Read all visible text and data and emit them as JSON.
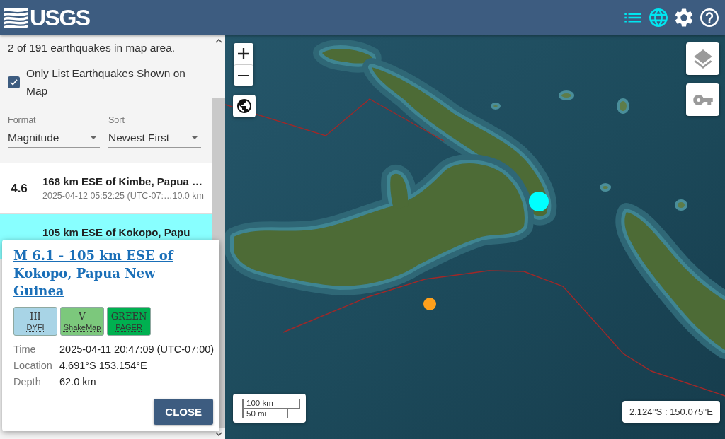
{
  "header": {
    "logo": "USGS",
    "nav": [
      {
        "kind": "list",
        "selected": true
      },
      {
        "kind": "map",
        "selected": true
      },
      {
        "kind": "settings",
        "selected": false
      },
      {
        "kind": "help",
        "selected": false
      }
    ]
  },
  "sidebar": {
    "summary": "2 of 191 earthquakes in map area.",
    "filter": {
      "label": "Only List Earthquakes Shown on Map",
      "checked": true
    },
    "format": {
      "label": "Format",
      "value": "Magnitude"
    },
    "sort": {
      "label": "Sort",
      "value": "Newest First"
    },
    "earthquakes": [
      {
        "magnitude": "4.6",
        "title": "168 km ESE of Kimbe, Papua …",
        "time": "2025-04-12 05:52:25 (UTC-07:…",
        "depth": "10.0 km",
        "selected": false
      },
      {
        "title": "105 km ESE of Kokopo, Papu",
        "selected": true
      }
    ]
  },
  "popup": {
    "title": "M 6.1 - 105 km ESE of Kokopo, Papua New Guinea",
    "badges": [
      {
        "value": "III",
        "label": "DYFI",
        "color": "#a8d4e6"
      },
      {
        "value": "V",
        "label": "ShakeMap",
        "color": "#7cc87c"
      },
      {
        "value": "GREEN",
        "label": "PAGER",
        "color": "#00b050"
      }
    ],
    "details": [
      {
        "label": "Time",
        "value": "2025-04-11 20:47:09 (UTC-07:00)"
      },
      {
        "label": "Location",
        "value": "4.691°S 153.154°E"
      },
      {
        "label": "Depth",
        "value": "62.0 km"
      }
    ],
    "close": "CLOSE"
  },
  "map": {
    "markers": [
      {
        "color": "#00ffff"
      },
      {
        "color": "#ffa01c"
      }
    ],
    "scale": [
      "100 km",
      "50 mi"
    ],
    "coordinates": "2.124°S : 150.075°E"
  }
}
